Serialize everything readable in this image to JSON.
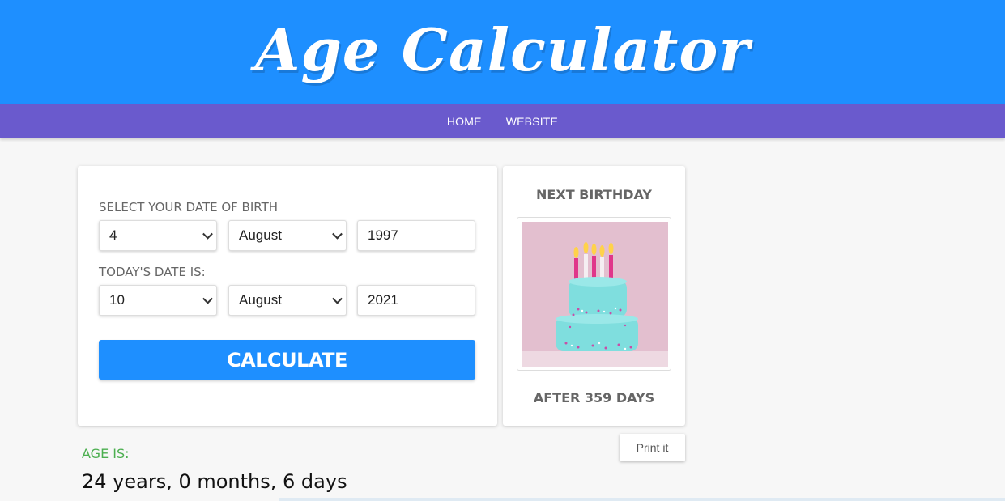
{
  "header": {
    "title": "Age Calculator",
    "bg_color": "#1e8fff"
  },
  "nav": {
    "bg_color": "#6a5acd",
    "items": [
      {
        "label": "HOME"
      },
      {
        "label": "WEBSITE"
      }
    ]
  },
  "form": {
    "dob_label": "SELECT YOUR DATE OF BIRTH",
    "dob": {
      "day": "4",
      "month": "August",
      "year": "1997"
    },
    "today_label": "TODAY'S DATE IS:",
    "today": {
      "day": "10",
      "month": "August",
      "year": "2021"
    },
    "calculate_label": "CALCULATE"
  },
  "next_birthday": {
    "title": "NEXT BIRTHDAY",
    "image": "birthday-cake-image",
    "after_text": "AFTER 359 DAYS"
  },
  "print_label": "Print it",
  "result": {
    "label": "AGE IS:",
    "value": "24 years, 0 months, 6 days"
  }
}
